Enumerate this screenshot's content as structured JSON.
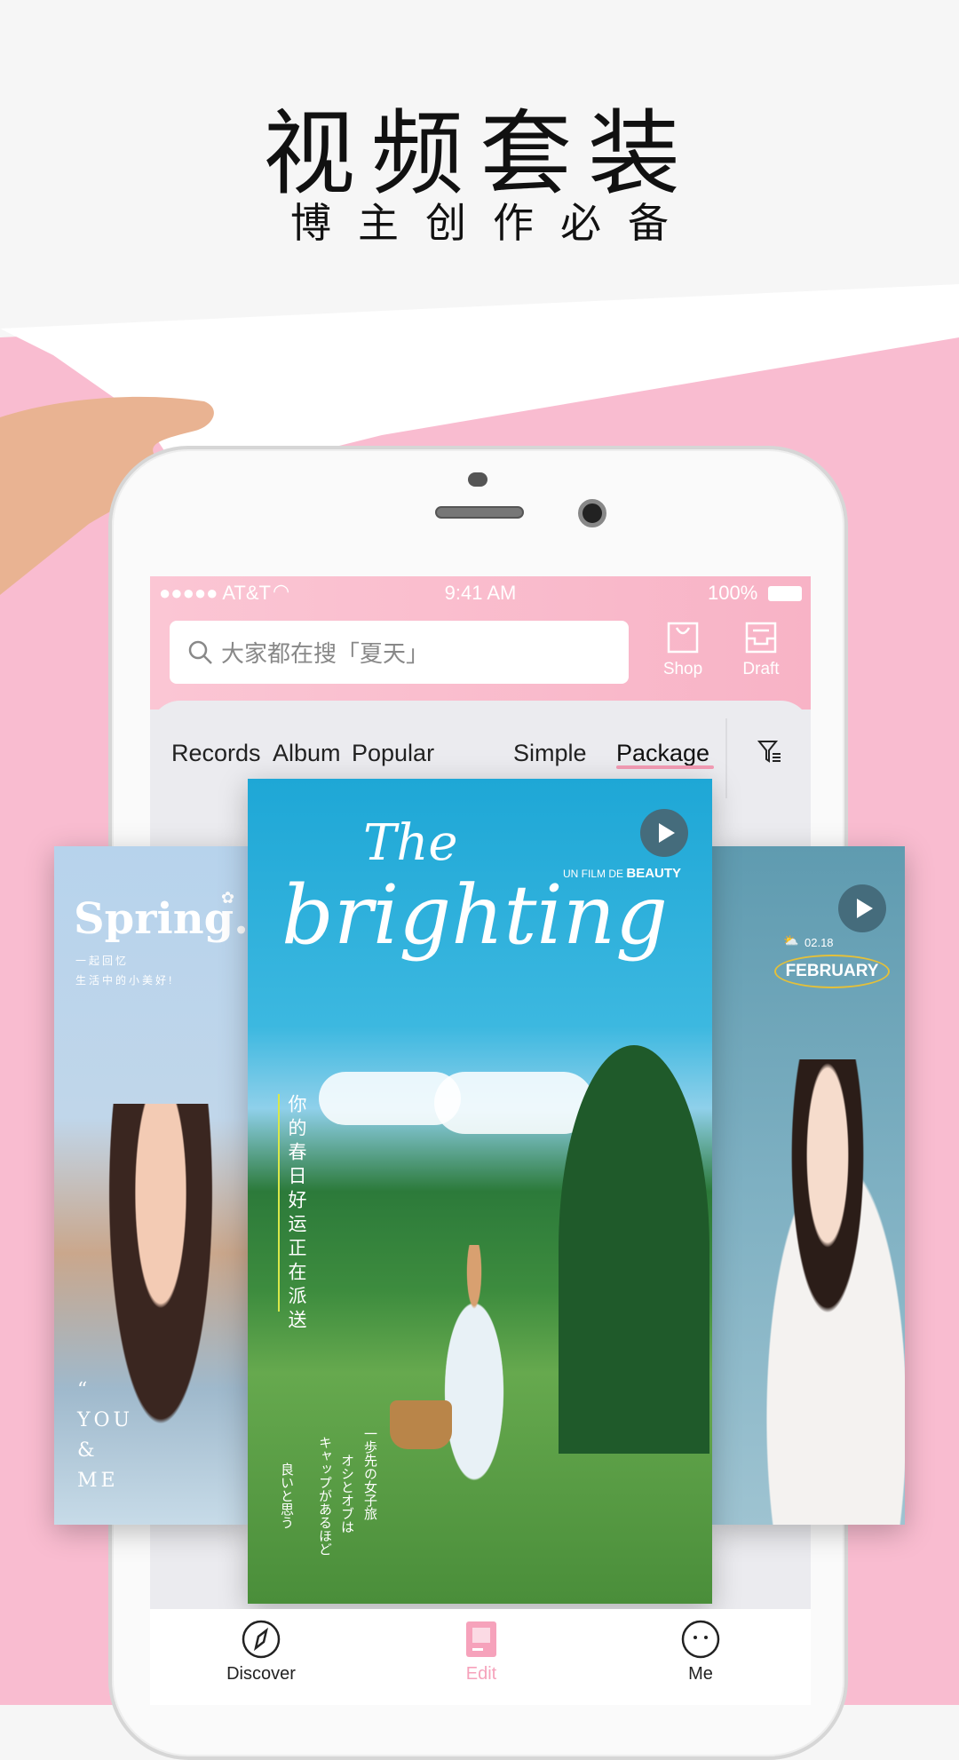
{
  "promo": {
    "title": "视频套装",
    "subtitle": "博主创作必备"
  },
  "status_bar": {
    "carrier": "●●●●● AT&T",
    "time": "9:41 AM",
    "battery": "100%"
  },
  "search": {
    "placeholder": "大家都在搜「夏天」",
    "icon": "search-icon"
  },
  "header_actions": [
    {
      "label": "Shop",
      "icon": "shopping-bag-icon"
    },
    {
      "label": "Draft",
      "icon": "drafts-tray-icon"
    }
  ],
  "tabs": [
    {
      "label": "Records"
    },
    {
      "label": "Album"
    },
    {
      "label": "Popular"
    },
    {
      "label": "Simple"
    },
    {
      "label": "Package",
      "active": true
    }
  ],
  "filter_icon": "filter-icon",
  "cards": {
    "left": {
      "title": "Spring.",
      "line1": "一起回忆",
      "line2": "生活中的小美好!",
      "quote": "“",
      "you": "YOU",
      "amp": "&",
      "me": "ME"
    },
    "center": {
      "title_the": "The",
      "title_main": "brighting",
      "credit_prefix": "UN FILM DE",
      "credit_name": "BEAUTY",
      "vertical": "你的春日好运正在派送",
      "jp": [
        "一歩先の女子旅",
        "オシとオブは",
        "キャップがあるほど",
        "良いと思う"
      ]
    },
    "right": {
      "date": "02.18",
      "month": "FEBRUARY"
    }
  },
  "bottom_nav": [
    {
      "label": "Discover",
      "icon": "compass-icon"
    },
    {
      "label": "Edit",
      "icon": "edit-icon",
      "active": true
    },
    {
      "label": "Me",
      "icon": "face-icon"
    }
  ],
  "colors": {
    "pink": "#f9bcd0",
    "accent": "#f6a2bb",
    "header": "#fbc6d4"
  }
}
